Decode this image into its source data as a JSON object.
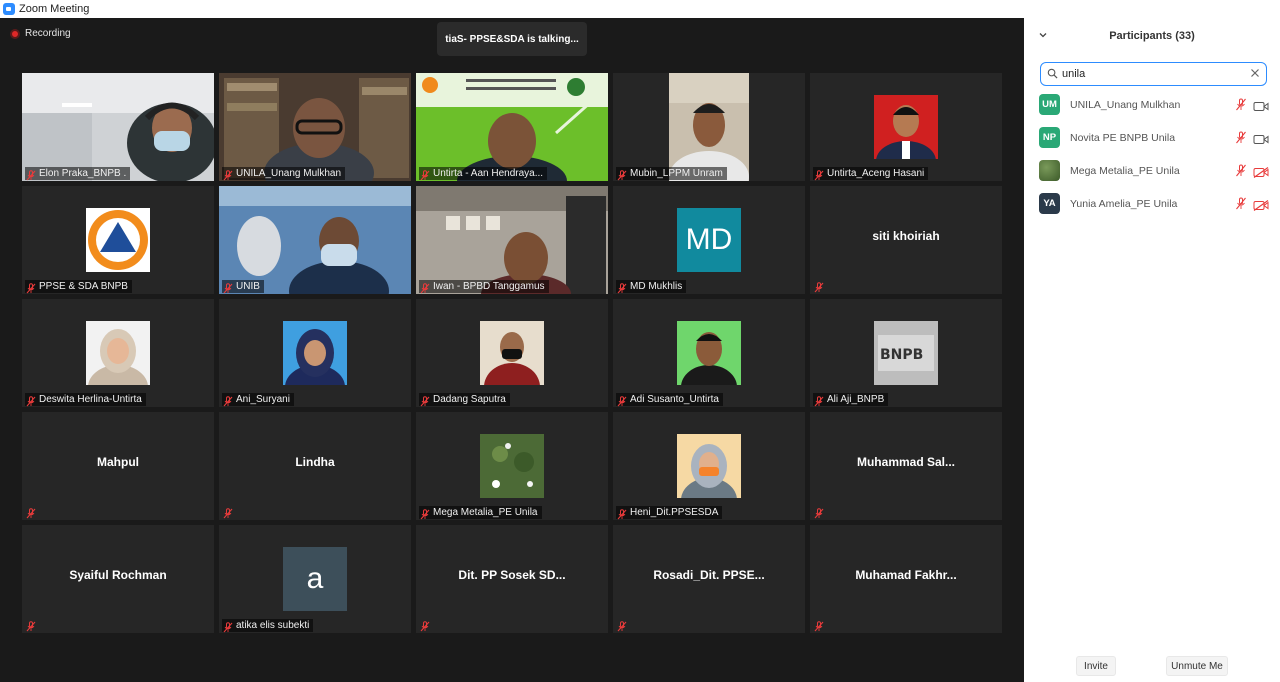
{
  "window": {
    "title": "Zoom Meeting",
    "minimize": "—",
    "restore": "❐",
    "close": "✕"
  },
  "meeting": {
    "recording_label": "Recording",
    "talking_banner": "tiaS- PPSE&SDA is talking...",
    "tiles": [
      {
        "name": "Elon Praka_BNPB .",
        "kind": "video"
      },
      {
        "name": "UNILA_Unang Mulkhan",
        "kind": "video"
      },
      {
        "name": "Untirta - Aan Hendraya...",
        "kind": "video"
      },
      {
        "name": "Mubin_LPPM Unram",
        "kind": "video"
      },
      {
        "name": "Untirta_Aceng Hasani",
        "kind": "photo"
      },
      {
        "name": "PPSE & SDA BNPB",
        "kind": "photo"
      },
      {
        "name": "UNIB",
        "kind": "video"
      },
      {
        "name": "Iwan - BPBD Tanggamus",
        "kind": "video"
      },
      {
        "name": "MD Mukhlis",
        "kind": "initials",
        "initials": "MD",
        "color": "#118a9e"
      },
      {
        "name": "",
        "big": "siti khoiriah",
        "kind": "text"
      },
      {
        "name": "Deswita Herlina-Untirta",
        "kind": "photo"
      },
      {
        "name": "Ani_Suryani",
        "kind": "photo"
      },
      {
        "name": "Dadang Saputra",
        "kind": "photo"
      },
      {
        "name": "Adi Susanto_Untirta",
        "kind": "photo"
      },
      {
        "name": "Ali Aji_BNPB",
        "kind": "photo"
      },
      {
        "name": "",
        "big": "Mahpul",
        "kind": "text"
      },
      {
        "name": "",
        "big": "Lindha",
        "kind": "text"
      },
      {
        "name": "Mega Metalia_PE Unila",
        "kind": "photo"
      },
      {
        "name": "Heni_Dit.PPSESDA",
        "kind": "photo"
      },
      {
        "name": "",
        "big": "Muhammad  Sal...",
        "kind": "text"
      },
      {
        "name": "",
        "big": "Syaiful Rochman",
        "kind": "text"
      },
      {
        "name": "atika elis subekti",
        "kind": "initials",
        "initials": "a",
        "color": "#3d4f5a"
      },
      {
        "name": "",
        "big": "Dit. PP Sosek SD...",
        "kind": "text"
      },
      {
        "name": "",
        "big": "Rosadi_Dit.  PPSE...",
        "kind": "text"
      },
      {
        "name": "",
        "big": "Muhamad  Fakhr...",
        "kind": "text"
      }
    ]
  },
  "participants": {
    "title": "Participants (33)",
    "search_value": "unila",
    "list": [
      {
        "initials": "UM",
        "name": "UNILA_Unang Mulkhan",
        "color": "#2aa876",
        "camera_on": true
      },
      {
        "initials": "NP",
        "name": "Novita PE BNPB Unila",
        "color": "#2aa876",
        "camera_on": true
      },
      {
        "initials": "",
        "name": "Mega Metalia_PE Unila",
        "color": "#4a6b3a",
        "camera_on": false
      },
      {
        "initials": "YA",
        "name": "Yunia Amelia_PE Unila",
        "color": "#2b3a4a",
        "camera_on": false
      }
    ],
    "invite_label": "Invite",
    "unmute_label": "Unmute Me"
  }
}
